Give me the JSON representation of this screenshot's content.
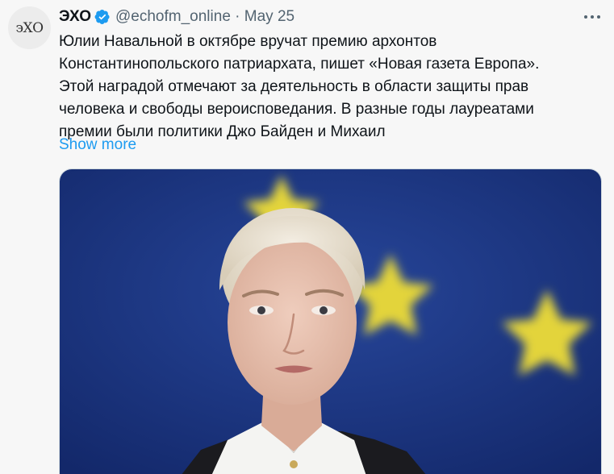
{
  "author": {
    "avatar_text": "эХО",
    "name": "ЭХО",
    "handle": "@echofm_online",
    "separator": "·",
    "date": "May 25"
  },
  "tweet": {
    "lines": [
      "Юлии Навальной в октябре вручат премию архонтов",
      "Константинопольского патриархата, пишет «Новая газета Европа».",
      "Этой наградой отмечают за деятельность в области защиты прав",
      "человека и свободы вероисповедания. В разные годы лауреатами",
      "премии были политики Джо Байден и Михаил"
    ],
    "show_more": "Show more"
  },
  "colors": {
    "link": "#1d9bf0",
    "verified": "#1d9bf0",
    "flag_blue": "#1b3a8c",
    "star": "#e3d43a"
  },
  "icons": [
    "verified-badge-icon",
    "more-options-icon"
  ]
}
